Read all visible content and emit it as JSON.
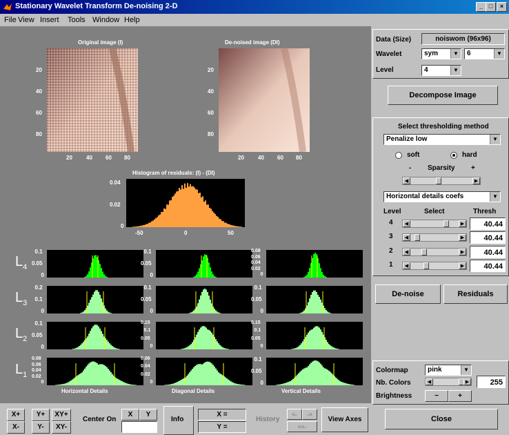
{
  "window": {
    "title": "Stationary Wavelet Transform De-noising 2-D",
    "min": "_",
    "max": "□",
    "close": "×"
  },
  "menu": [
    "File",
    "View",
    "Insert",
    "Tools",
    "Window",
    "Help"
  ],
  "plots": {
    "original_title": "Original image (I)",
    "denoised_title": "De-noised image (DI)",
    "y_ticks": [
      "20",
      "40",
      "60",
      "80"
    ],
    "x_ticks": [
      "20",
      "40",
      "60",
      "80"
    ],
    "hist_title": "Histogram of residuals: (I) - (DI)",
    "hist_y_ticks": [
      "0.04",
      "0.02",
      "0"
    ],
    "hist_x_ticks": [
      "-50",
      "0",
      "50"
    ],
    "level_labels": [
      "L4",
      "L3",
      "L2",
      "L1"
    ],
    "col_labels": [
      "Horizontal Details",
      "Diagonal Details",
      "Vertical Details"
    ],
    "detail_y_ticks": [
      [
        [
          "0.1",
          "0.05",
          "0"
        ],
        [
          "0.1",
          "0.05",
          "0"
        ],
        [
          "0.08",
          "0.06",
          "0.04",
          "0.02",
          "0"
        ]
      ],
      [
        [
          "0.2",
          "0.1",
          "0"
        ],
        [
          "0.1",
          "0.05",
          "0"
        ],
        [
          "0.1",
          "0.05",
          "0"
        ]
      ],
      [
        [
          "0.1",
          "0.05",
          "0"
        ],
        [
          "0.15",
          "0.1",
          "0.05",
          "0"
        ],
        [
          "0.15",
          "0.1",
          "0.05",
          "0"
        ]
      ],
      [
        [
          "0.08",
          "0.06",
          "0.04",
          "0.02",
          "0"
        ],
        [
          "0.06",
          "0.04",
          "0.02",
          "0"
        ],
        [
          "0.1",
          "0.05",
          "0"
        ]
      ]
    ]
  },
  "colors": {
    "hist_bar": "#ffa040",
    "detail_bar_top": "#00ff00",
    "detail_bar_low": "#a0ffa0",
    "threshold_line": "#ffff00",
    "background": "#808080"
  },
  "right_panel": {
    "data_label": "Data  (Size)",
    "data_value": "noiswom  (96x96)",
    "wavelet_label": "Wavelet",
    "wavelet_value": "sym",
    "wavelet_order": "6",
    "level_label": "Level",
    "level_value": "4",
    "decompose_button": "Decompose Image",
    "thresh_title": "Select thresholding method",
    "thresh_method": "Penalize low",
    "soft_label": "soft",
    "hard_label": "hard",
    "sparsity_minus": "-",
    "sparsity_label": "Sparsity",
    "sparsity_plus": "+",
    "coef_select": "Horizontal details coefs",
    "col_level": "Level",
    "col_select": "Select",
    "col_thresh": "Thresh",
    "levels": [
      {
        "level": "4",
        "thresh": "40.44",
        "thumb_pos": 0.75
      },
      {
        "level": "3",
        "thresh": "40.44",
        "thumb_pos": 0.1
      },
      {
        "level": "2",
        "thresh": "40.44",
        "thumb_pos": 0.25
      },
      {
        "level": "1",
        "thresh": "40.44",
        "thumb_pos": 0.3
      }
    ],
    "denoise_button": "De-noise",
    "residuals_button": "Residuals",
    "colormap_label": "Colormap",
    "colormap_value": "pink",
    "nbcolors_label": "Nb. Colors",
    "nbcolors_value": "255",
    "brightness_label": "Brightness",
    "brightness_minus": "−",
    "brightness_plus": "+",
    "close_button": "Close"
  },
  "bottom": {
    "xplus": "X+",
    "yplus": "Y+",
    "xyplus": "XY+",
    "xminus": "X-",
    "yminus": "Y-",
    "xyminus": "XY-",
    "center_on": "Center On",
    "x": "X",
    "y": "Y",
    "info": "Info",
    "x_eq": "X =",
    "y_eq": "Y =",
    "history": "History",
    "hist_left": "<-",
    "hist_right": "->",
    "hist_back": "<<-",
    "view_axes": "View Axes"
  }
}
